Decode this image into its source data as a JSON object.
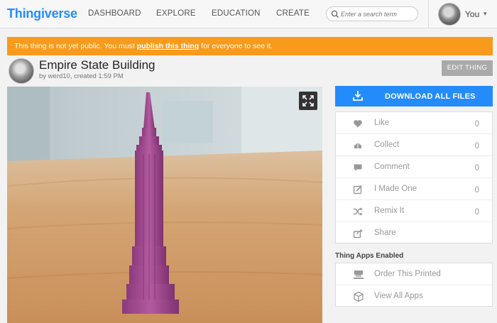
{
  "header": {
    "logo": "Thingiverse",
    "nav": [
      {
        "label": "DASHBOARD"
      },
      {
        "label": "EXPLORE"
      },
      {
        "label": "EDUCATION"
      },
      {
        "label": "CREATE"
      }
    ],
    "search_placeholder": "Enter a search term",
    "user_label": "You",
    "caret": "▾"
  },
  "notice": {
    "before": "This thing is not yet public. You must ",
    "link": "publish this thing",
    "after": " for everyone to see it."
  },
  "thing": {
    "title": "Empire State Building",
    "byline": "by werd10, created 1:59 PM",
    "edit_label": "EDIT THING"
  },
  "download": {
    "label": "DOWNLOAD ALL FILES"
  },
  "actions": [
    {
      "label": "Like",
      "count": "0",
      "icon": "heart-icon"
    },
    {
      "label": "Collect",
      "count": "0",
      "icon": "collect-icon"
    },
    {
      "label": "Comment",
      "count": "0",
      "icon": "comment-icon"
    },
    {
      "label": "I Made One",
      "count": "0",
      "icon": "made-one-icon"
    },
    {
      "label": "Remix It",
      "count": "0",
      "icon": "shuffle-icon"
    },
    {
      "label": "Share",
      "count": "",
      "icon": "share-icon"
    }
  ],
  "apps": {
    "header": "Thing Apps Enabled",
    "items": [
      {
        "label": "Order This Printed",
        "icon": "printer-icon"
      },
      {
        "label": "View All Apps",
        "icon": "cube-icon"
      }
    ]
  },
  "colors": {
    "brand": "#248bfb",
    "notice": "#f89a1c",
    "edit_button": "#aaaaaa",
    "model": "#a24a8f"
  }
}
